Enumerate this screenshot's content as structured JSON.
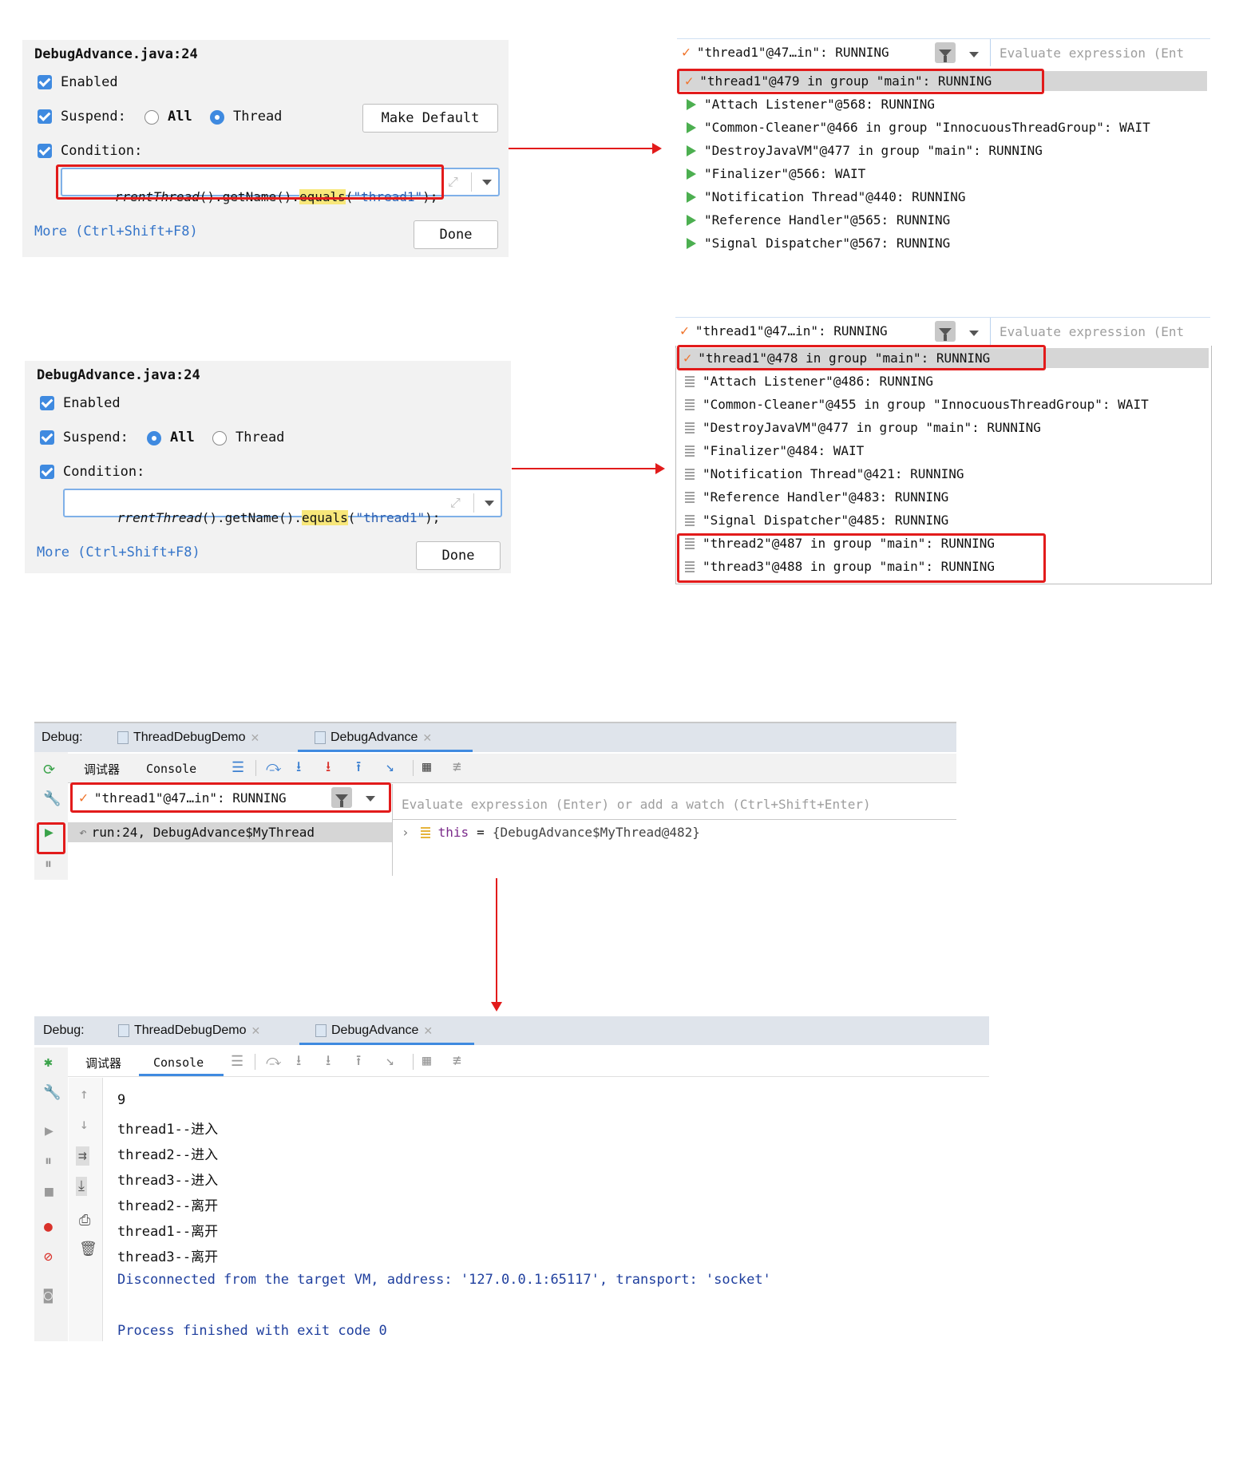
{
  "dialog1": {
    "title": "DebugAdvance.java:24",
    "enabled_label": "Enabled",
    "suspend_label": "Suspend:",
    "all_label": "All",
    "thread_label": "Thread",
    "suspend_selected": "Thread",
    "make_default_label": "Make Default",
    "condition_label": "Condition:",
    "condition_parts": [
      "rrentThread",
      "().getName().",
      "equals",
      "(",
      "\"thread1\"",
      ");"
    ],
    "more_label": "More (Ctrl+Shift+F8)",
    "done_label": "Done"
  },
  "dialog2": {
    "title": "DebugAdvance.java:24",
    "enabled_label": "Enabled",
    "suspend_label": "Suspend:",
    "all_label": "All",
    "thread_label": "Thread",
    "suspend_selected": "All",
    "condition_label": "Condition:",
    "condition_parts": [
      "rrentThread",
      "().getName().",
      "equals",
      "(",
      "\"thread1\"",
      ");"
    ],
    "more_label": "More (Ctrl+Shift+F8)",
    "done_label": "Done"
  },
  "threads1": {
    "selected": "\"thread1\"@47…in\": RUNNING",
    "eval_placeholder": "Evaluate expression (Ent",
    "rows": [
      "\"thread1\"@479 in group \"main\": RUNNING",
      "\"Attach Listener\"@568: RUNNING",
      "\"Common-Cleaner\"@466 in group \"InnocuousThreadGroup\": WAIT",
      "\"DestroyJavaVM\"@477 in group \"main\": RUNNING",
      "\"Finalizer\"@566: WAIT",
      "\"Notification Thread\"@440: RUNNING",
      "\"Reference Handler\"@565: RUNNING",
      "\"Signal Dispatcher\"@567: RUNNING"
    ]
  },
  "threads2": {
    "selected": "\"thread1\"@47…in\": RUNNING",
    "eval_placeholder": "Evaluate expression (Ent",
    "rows": [
      "\"thread1\"@478 in group \"main\": RUNNING",
      "\"Attach Listener\"@486: RUNNING",
      "\"Common-Cleaner\"@455 in group \"InnocuousThreadGroup\": WAIT",
      "\"DestroyJavaVM\"@477 in group \"main\": RUNNING",
      "\"Finalizer\"@484: WAIT",
      "\"Notification Thread\"@421: RUNNING",
      "\"Reference Handler\"@483: RUNNING",
      "\"Signal Dispatcher\"@485: RUNNING",
      "\"thread2\"@487 in group \"main\": RUNNING",
      "\"thread3\"@488 in group \"main\": RUNNING"
    ]
  },
  "debug1": {
    "debug_label": "Debug:",
    "tabs": [
      "ThreadDebugDemo",
      "DebugAdvance"
    ],
    "debugger_tab": "调试器",
    "console_tab": "Console",
    "selected_thread": "\"thread1\"@47…in\": RUNNING",
    "eval_placeholder": "Evaluate expression (Enter) or add a watch (Ctrl+Shift+Enter)",
    "frame": "run:24, DebugAdvance$MyThread",
    "var_name": "this",
    "var_eq": "=",
    "var_value": "{DebugAdvance$MyThread@482}"
  },
  "debug2": {
    "debug_label": "Debug:",
    "tabs": [
      "ThreadDebugDemo",
      "DebugAdvance"
    ],
    "debugger_tab": "调试器",
    "console_tab": "Console",
    "console_lines": [
      "9",
      "thread1--进入",
      "thread2--进入",
      "thread3--进入",
      "thread2--离开",
      "thread1--离开",
      "thread3--离开"
    ],
    "disconnected": "Disconnected from the target VM, address: '127.0.0.1:65117', transport: 'socket'",
    "finished": "Process finished with exit code 0"
  },
  "colors": {
    "accent": "#3f8ae0",
    "highlight_red": "#e21b1b",
    "running_green": "#4caf50",
    "check_orange": "#f0732a"
  }
}
